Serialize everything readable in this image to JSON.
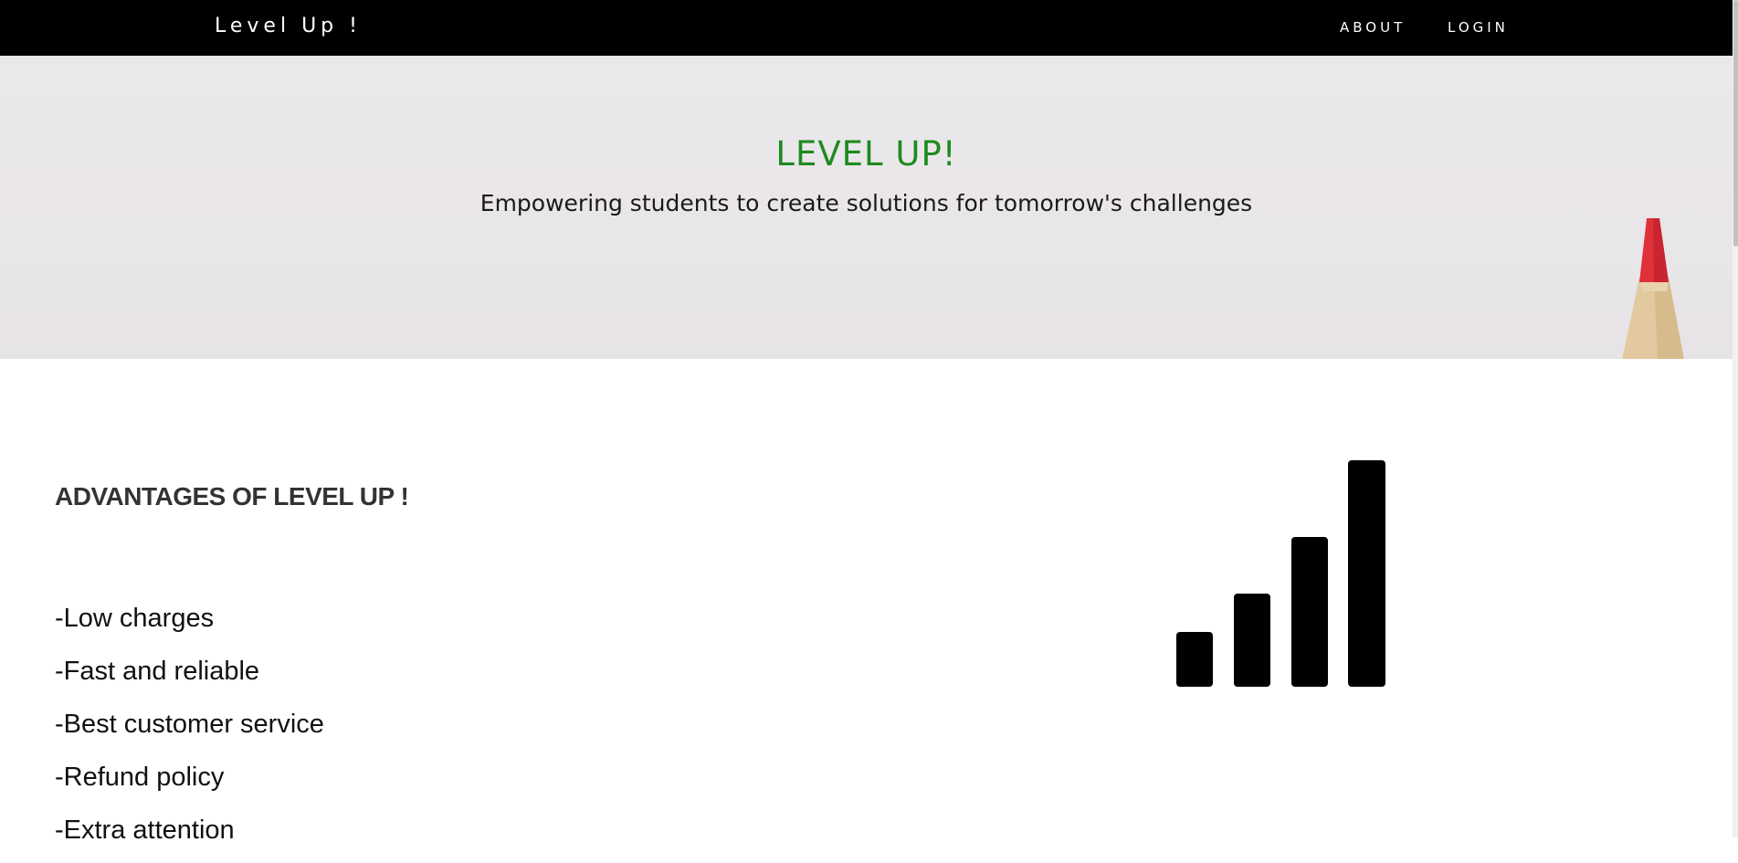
{
  "navbar": {
    "brand": "Level Up !",
    "links": [
      "ABOUT",
      "LOGIN"
    ]
  },
  "hero": {
    "title": "LEVEL UP!",
    "subtitle": "Empowering students to create solutions for tomorrow's challenges"
  },
  "advantages": {
    "heading": "ADVANTAGES OF LEVEL UP !",
    "items": [
      "-Low charges",
      "-Fast and reliable",
      "-Best customer service",
      "-Refund policy",
      "-Extra attention"
    ]
  },
  "icons": {
    "signal": "signal-bars-icon",
    "pencil": "pencil-image"
  },
  "colors": {
    "navbar_bg": "#000000",
    "hero_title": "#1f8a1f",
    "hero_bg": "#eae7ea"
  }
}
